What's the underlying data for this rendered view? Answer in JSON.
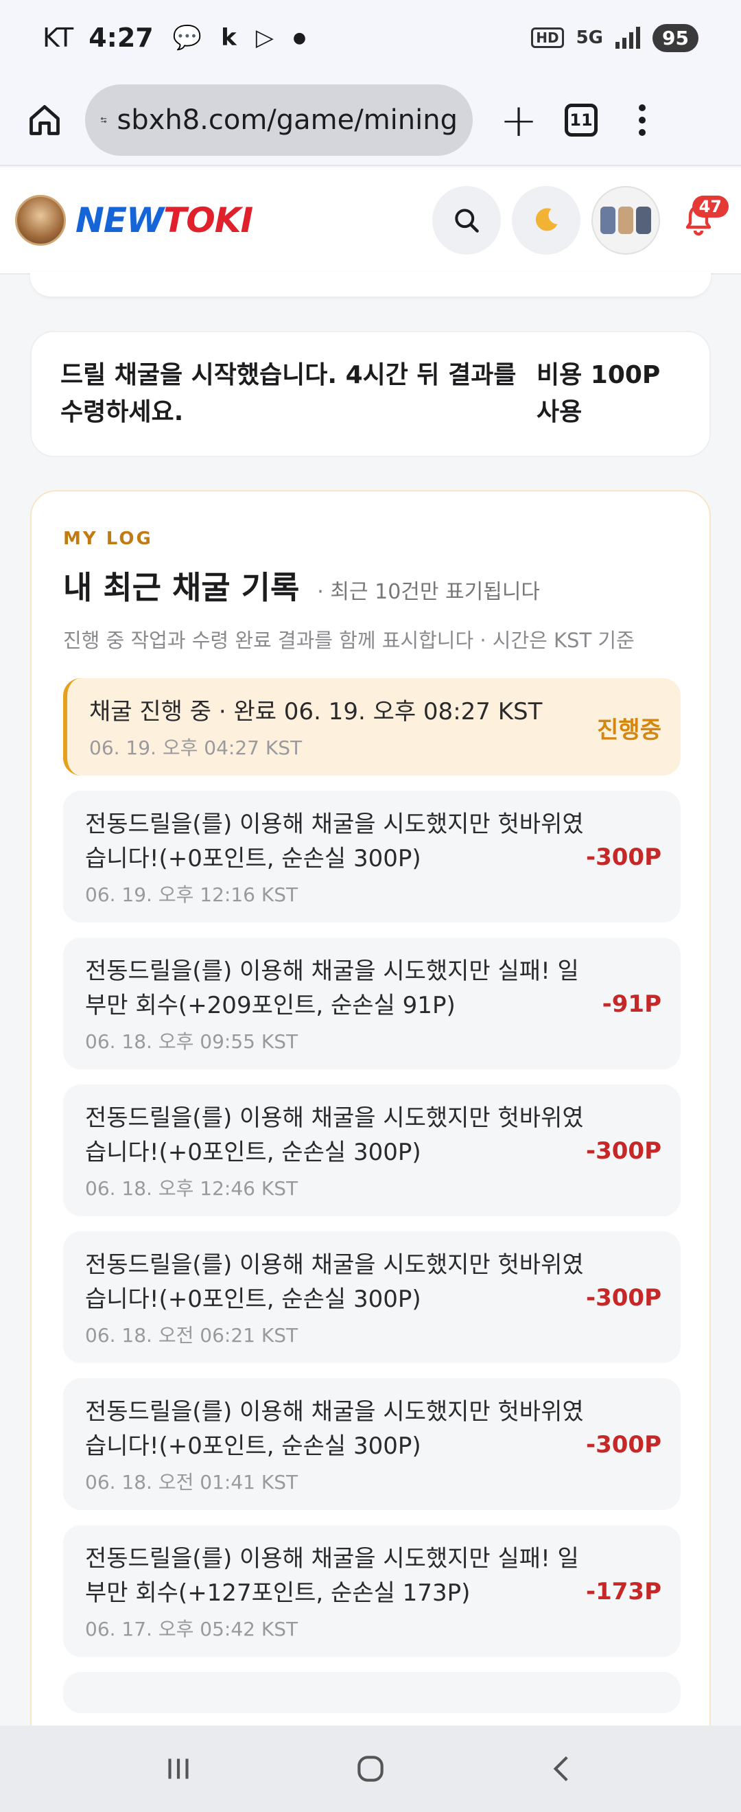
{
  "status_bar": {
    "carrier": "KT",
    "time": "4:27",
    "icons": [
      "talk-icon",
      "k-icon",
      "play-icon",
      "dot-icon"
    ],
    "hd": "HD",
    "network": "5G",
    "battery": "95"
  },
  "browser": {
    "url": "sbxh8.com/game/mining",
    "tab_count": "11"
  },
  "site": {
    "logo_new": "NEW",
    "logo_toki": "TOKI",
    "notification_count": "47"
  },
  "notice": {
    "message": "드릴 채굴을 시작했습니다. 4시간 뒤 결과를 수령하세요.",
    "cost": "비용 100P 사용"
  },
  "log": {
    "eyebrow": "MY LOG",
    "title": "내 최근 채굴 기록",
    "subnote": "· 최근 10건만 표기됩니다",
    "description": "진행 중 작업과 수령 완료 결과를 함께 표시합니다 · 시간은 KST 기준",
    "entries": [
      {
        "title": "채굴 진행 중 · 완료 06. 19. 오후 08:27 KST",
        "time": "06. 19. 오후 04:27 KST",
        "amount": "진행중"
      },
      {
        "title": "전동드릴을(를) 이용해 채굴을 시도했지만 헛바위였습니다!(+0포인트, 순손실 300P)",
        "time": "06. 19. 오후 12:16 KST",
        "amount": "-300P"
      },
      {
        "title": "전동드릴을(를) 이용해 채굴을 시도했지만 실패! 일부만 회수(+209포인트, 순손실 91P)",
        "time": "06. 18. 오후 09:55 KST",
        "amount": "-91P"
      },
      {
        "title": "전동드릴을(를) 이용해 채굴을 시도했지만 헛바위였습니다!(+0포인트, 순손실 300P)",
        "time": "06. 18. 오후 12:46 KST",
        "amount": "-300P"
      },
      {
        "title": "전동드릴을(를) 이용해 채굴을 시도했지만 헛바위였습니다!(+0포인트, 순손실 300P)",
        "time": "06. 18. 오전 06:21 KST",
        "amount": "-300P"
      },
      {
        "title": "전동드릴을(를) 이용해 채굴을 시도했지만 헛바위였습니다!(+0포인트, 순손실 300P)",
        "time": "06. 18. 오전 01:41 KST",
        "amount": "-300P"
      },
      {
        "title": "전동드릴을(를) 이용해 채굴을 시도했지만 실패! 일부만 회수(+127포인트, 순손실 173P)",
        "time": "06. 17. 오후 05:42 KST",
        "amount": "-173P"
      }
    ]
  },
  "colors": {
    "accent_orange": "#c27b13",
    "loss_red": "#c62828",
    "active_bg": "#fdf1de",
    "logo_blue": "#1565d8",
    "logo_red": "#e0202a"
  }
}
